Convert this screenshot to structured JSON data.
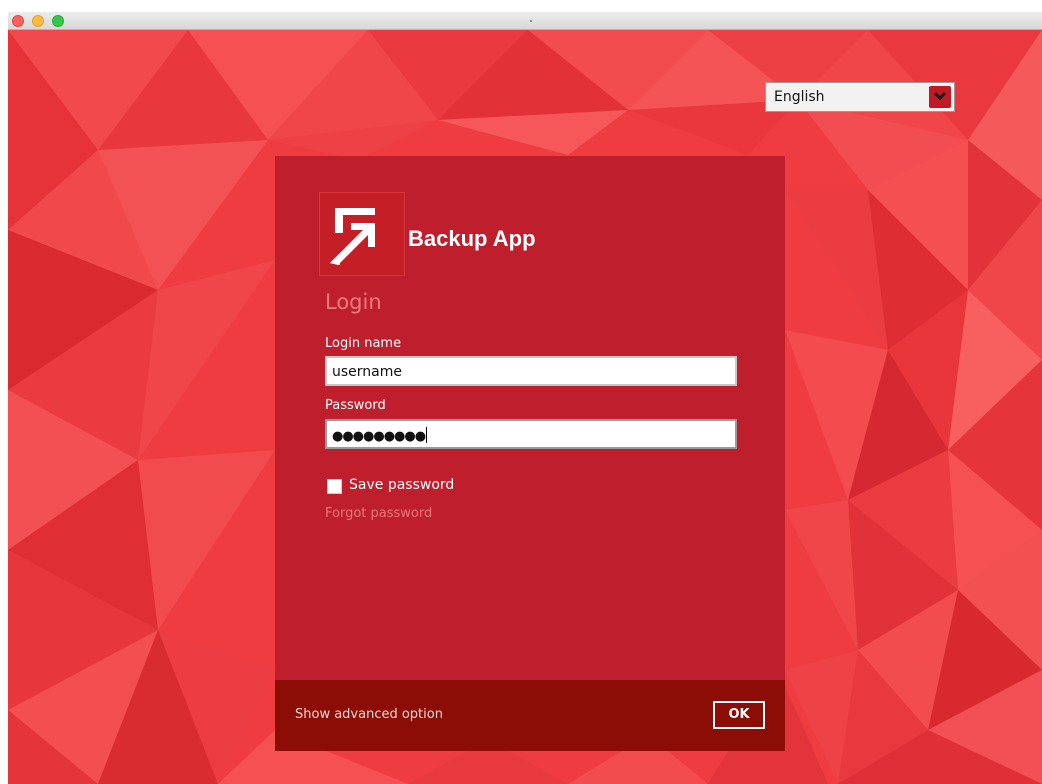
{
  "window": {
    "controls": [
      "close",
      "minimize",
      "maximize"
    ]
  },
  "language_select": {
    "value": "English",
    "icon": "chevron-down-icon"
  },
  "login_panel": {
    "app_name": "Backup App",
    "logo_icon": "backup-app-logo-icon",
    "heading": "Login",
    "login_name_label": "Login name",
    "login_name_value": "username",
    "password_label": "Password",
    "password_value": "●●●●●●●●●",
    "save_password_label": "Save password",
    "save_password_checked": false,
    "forgot_password_link": "Forgot password",
    "advanced_option_link": "Show advanced option",
    "ok_button": "OK"
  },
  "colors": {
    "background": "#ee3c40",
    "panel": "#bf1e2d",
    "footer": "#8b0d05",
    "accent_text": "#f07b7f"
  }
}
